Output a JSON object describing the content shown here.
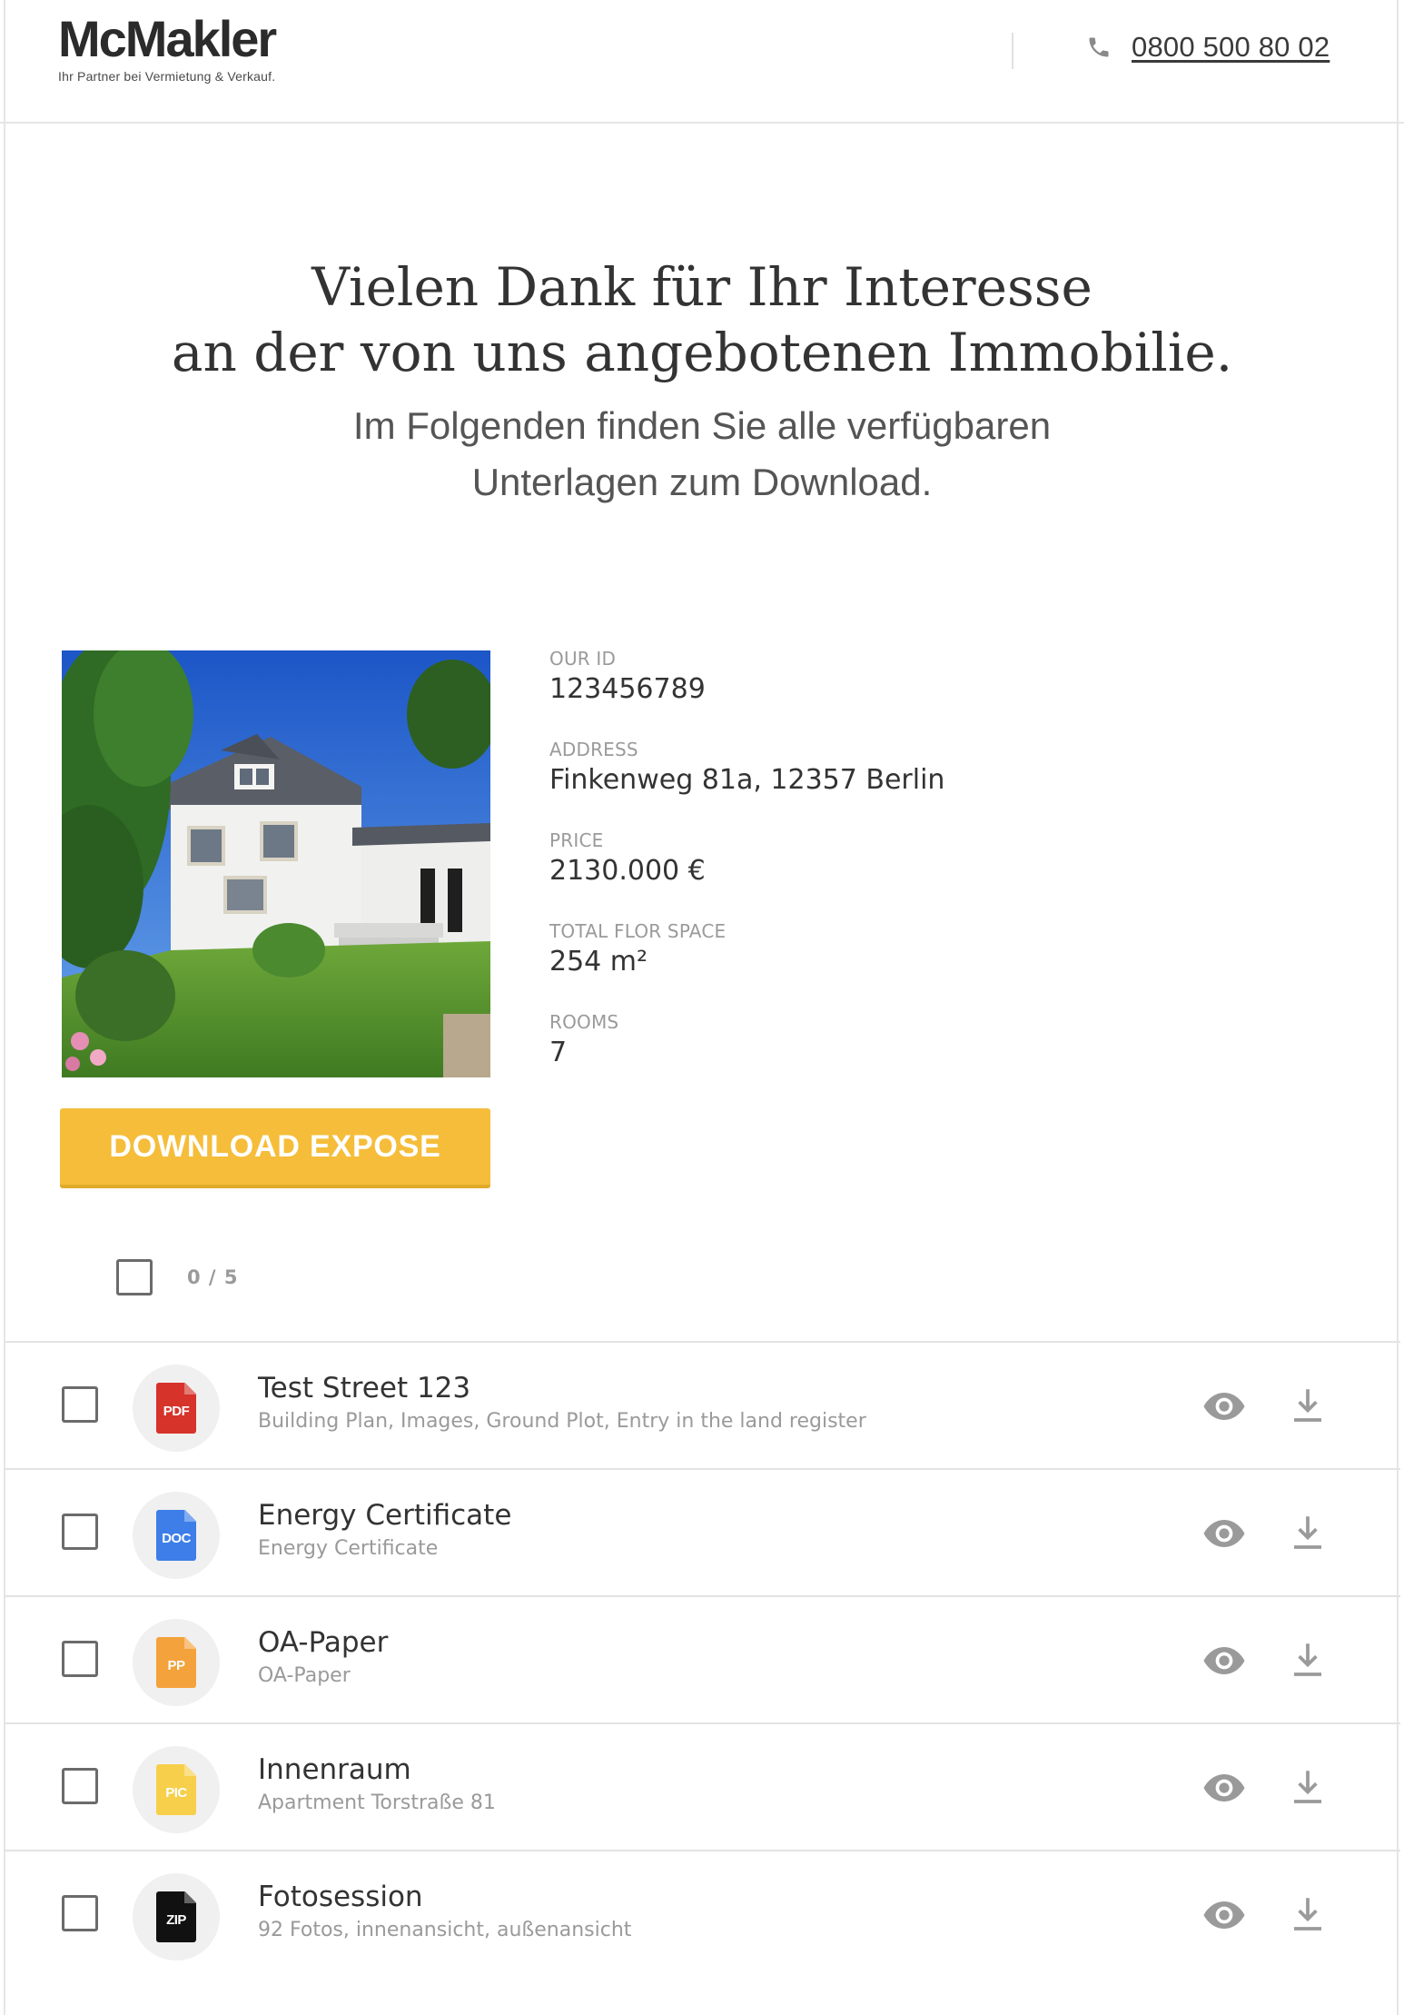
{
  "header": {
    "logo_text": "McMakler",
    "tagline": "Ihr Partner bei Vermietung & Verkauf.",
    "phone": "0800 500 80 02"
  },
  "hero": {
    "title_line1": "Vielen Dank für Ihr Interesse",
    "title_line2": "an der von uns angebotenen Immobilie.",
    "sub_line1": "Im Folgenden finden Sie alle verfügbaren",
    "sub_line2": "Unterlagen zum Download."
  },
  "property": {
    "details": [
      {
        "label": "OUR ID",
        "value": "123456789"
      },
      {
        "label": "ADDRESS",
        "value": "Finkenweg 81a, 12357 Berlin"
      },
      {
        "label": "PRICE",
        "value": "2130.000 €"
      },
      {
        "label": "TOTAL FLOR SPACE",
        "value": "254 m²"
      },
      {
        "label": "ROOMS",
        "value": "7"
      }
    ],
    "download_label": "DOWNLOAD EXPOSE"
  },
  "selection": {
    "count_text": "0 / 5"
  },
  "documents": [
    {
      "type": "PDF",
      "title": "Test Street 123",
      "description": "Building Plan, Images, Ground Plot, Entry in the land register",
      "color": "#d6332a"
    },
    {
      "type": "DOC",
      "title": "Energy Certificate",
      "description": "Energy Certificate",
      "color": "#3d7ee8"
    },
    {
      "type": "PP",
      "title": "OA-Paper",
      "description": "OA-Paper",
      "color": "#f4a23c"
    },
    {
      "type": "PIC",
      "title": "Innenraum",
      "description": "Apartment Torstraße 81",
      "color": "#f7cf4a"
    },
    {
      "type": "ZIP",
      "title": "Fotosession",
      "description": "92 Fotos, innenansicht, außenansicht",
      "color": "#111111"
    }
  ],
  "icons": {
    "phone": "phone-icon",
    "view": "eye-icon",
    "download": "download-icon"
  },
  "colors": {
    "accent": "#f5bd3a",
    "text": "#333333",
    "muted": "#9a9a9a"
  }
}
